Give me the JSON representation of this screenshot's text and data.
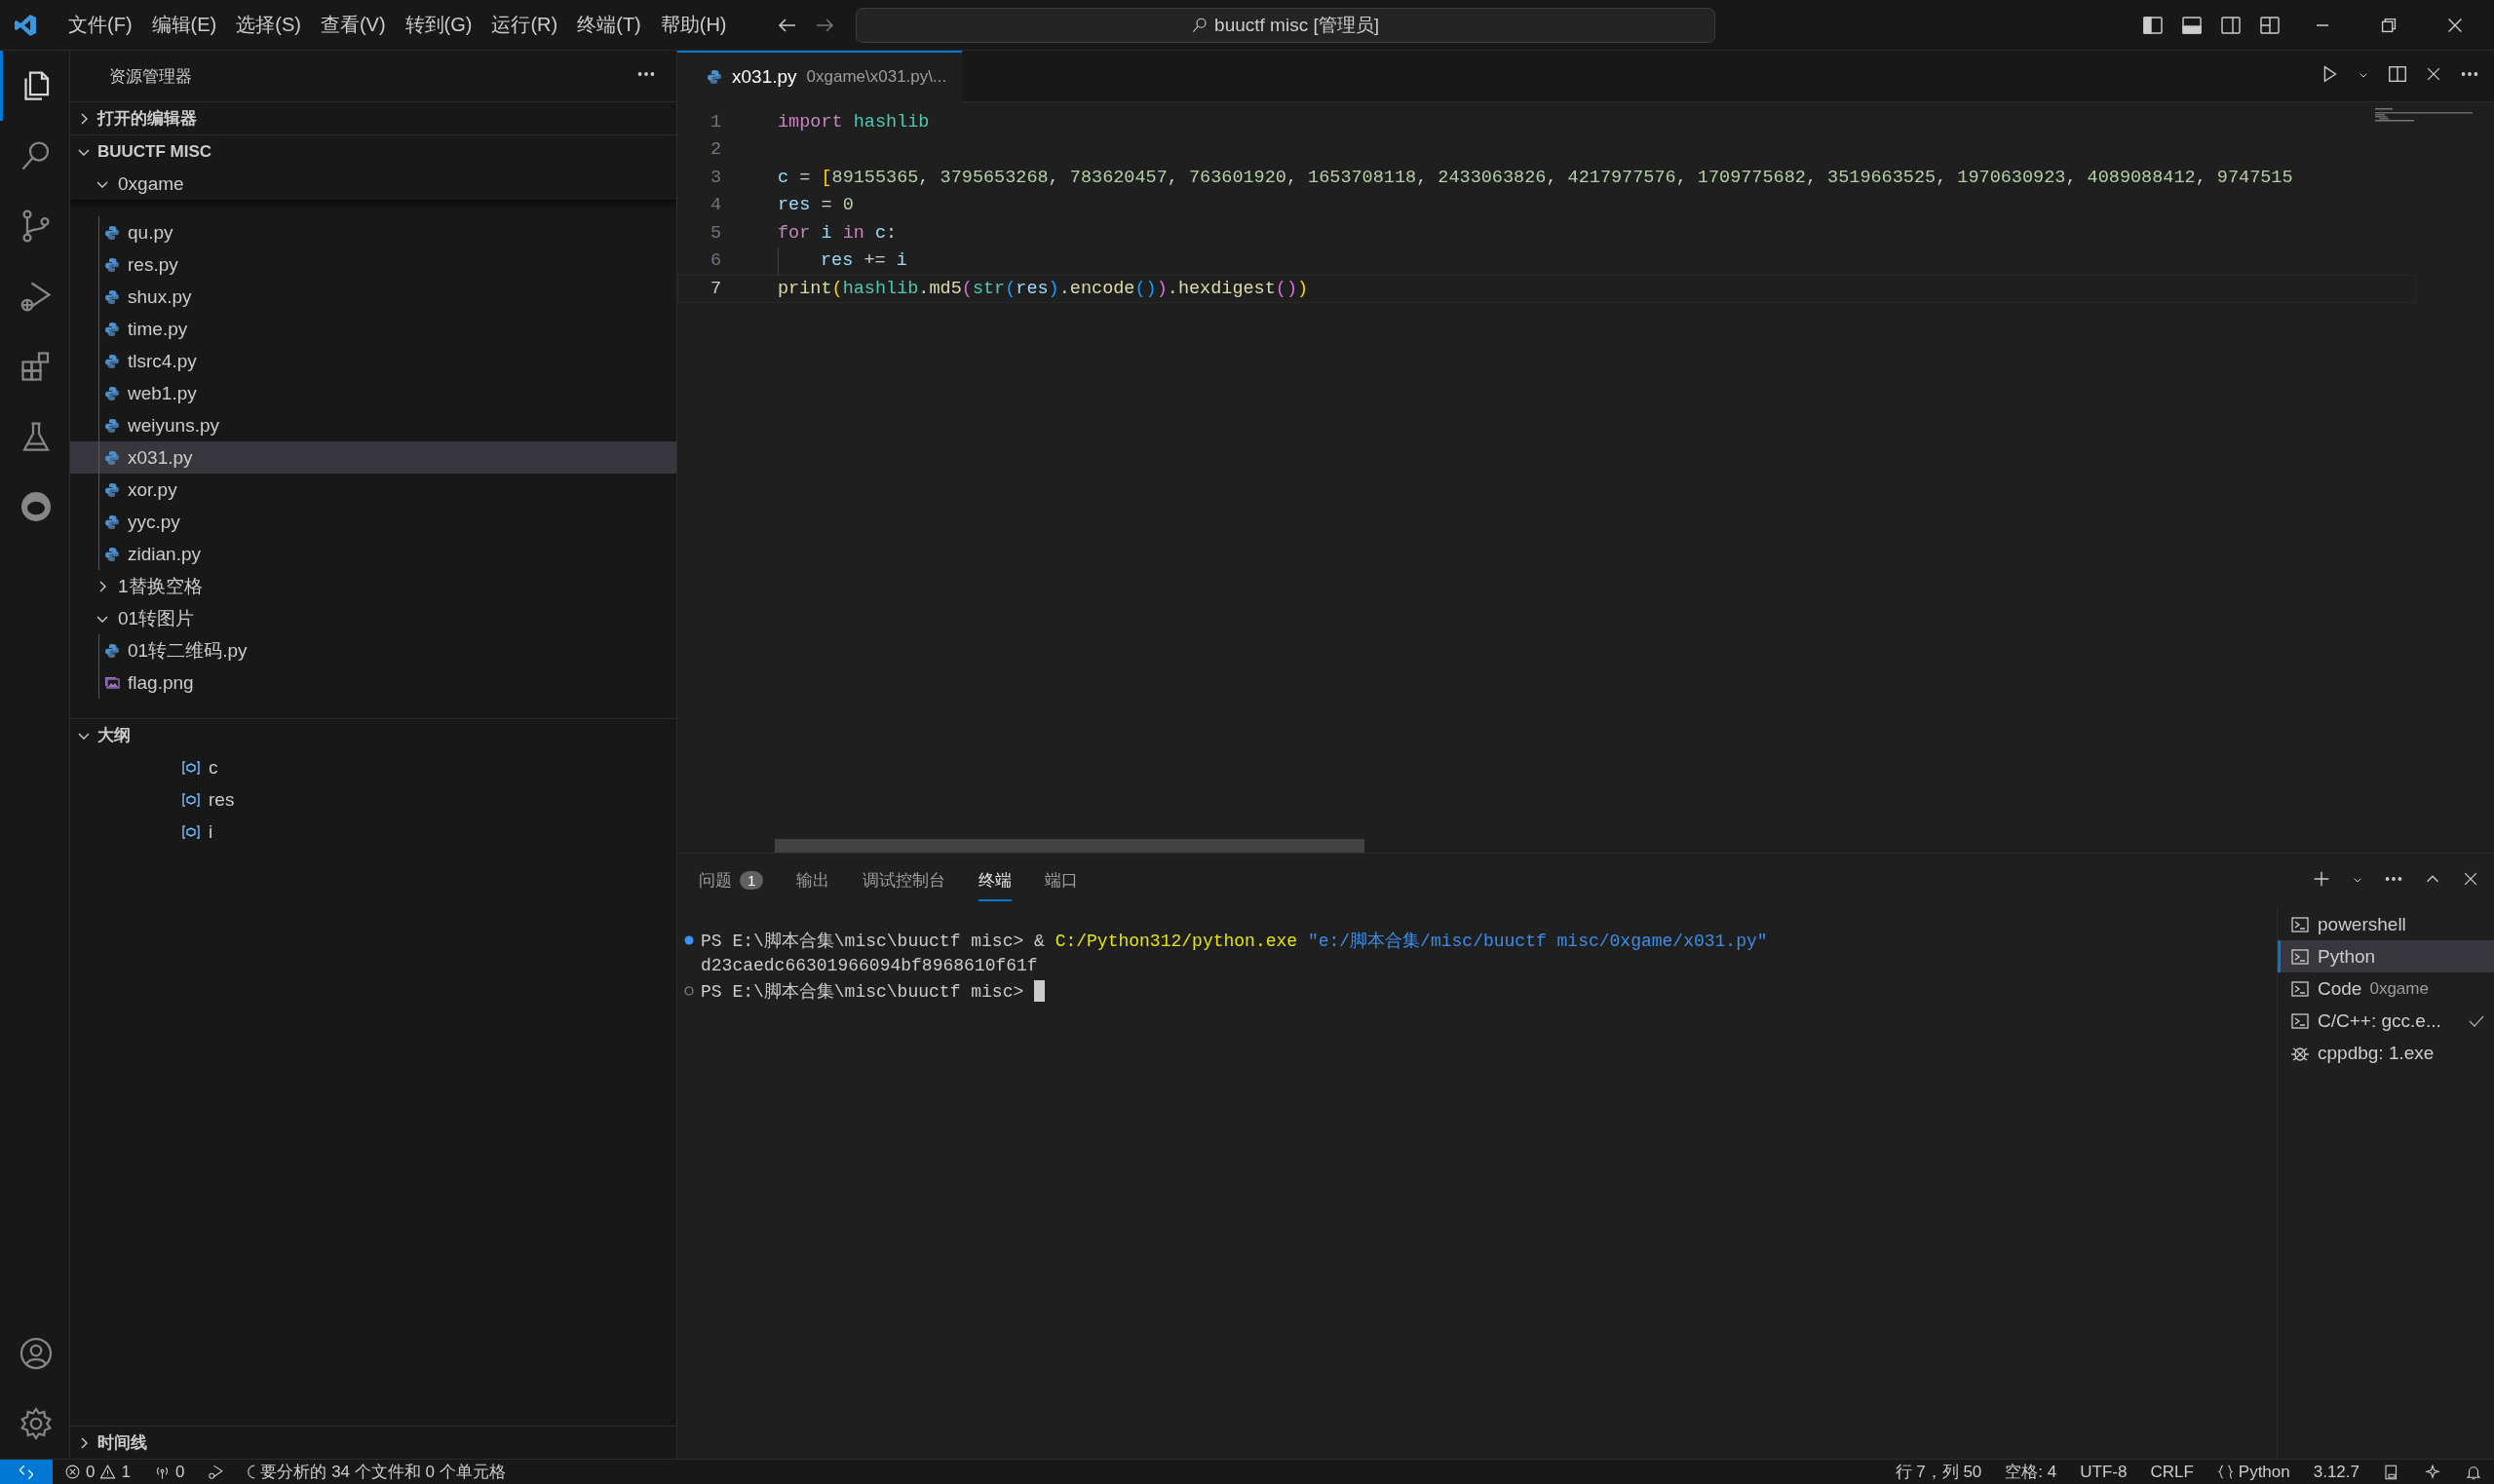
{
  "titlebar": {
    "menu": [
      "文件(F)",
      "编辑(E)",
      "选择(S)",
      "查看(V)",
      "转到(G)",
      "运行(R)",
      "终端(T)",
      "帮助(H)"
    ],
    "command_center": "buuctf misc [管理员]"
  },
  "activity_bar": [
    {
      "kind": "explorer",
      "selected": true
    },
    {
      "kind": "search",
      "selected": false
    },
    {
      "kind": "source-control",
      "selected": false
    },
    {
      "kind": "run-debug",
      "selected": false
    },
    {
      "kind": "extensions",
      "selected": false
    },
    {
      "kind": "testing",
      "selected": false
    },
    {
      "kind": "remote",
      "selected": false
    }
  ],
  "activity_bottom": [
    {
      "kind": "account"
    },
    {
      "kind": "settings"
    }
  ],
  "sidebar": {
    "title": "资源管理器",
    "open_editors": {
      "title": "打开的编辑器",
      "expanded": false
    },
    "folder": {
      "title": "BUUCTF MISC",
      "expanded": true,
      "tree": [
        {
          "name": "0xgame",
          "kind": "folder",
          "expanded": true,
          "selected": false,
          "children": [
            {
              "name": "qu.py",
              "kind": "python",
              "selected": false
            },
            {
              "name": "res.py",
              "kind": "python",
              "selected": false
            },
            {
              "name": "shux.py",
              "kind": "python",
              "selected": false
            },
            {
              "name": "time.py",
              "kind": "python",
              "selected": false
            },
            {
              "name": "tlsrc4.py",
              "kind": "python",
              "selected": false
            },
            {
              "name": "web1.py",
              "kind": "python",
              "selected": false
            },
            {
              "name": "weiyuns.py",
              "kind": "python",
              "selected": false
            },
            {
              "name": "x031.py",
              "kind": "python",
              "selected": true
            },
            {
              "name": "xor.py",
              "kind": "python",
              "selected": false
            },
            {
              "name": "yyc.py",
              "kind": "python",
              "selected": false
            },
            {
              "name": "zidian.py",
              "kind": "python",
              "selected": false
            }
          ]
        },
        {
          "name": "1替换空格",
          "kind": "folder",
          "expanded": false,
          "selected": false
        },
        {
          "name": "01转图片",
          "kind": "folder",
          "expanded": true,
          "selected": false,
          "children": [
            {
              "name": "01转二维码.py",
              "kind": "python",
              "selected": false
            },
            {
              "name": "flag.png",
              "kind": "image",
              "selected": false
            }
          ]
        }
      ]
    },
    "outline": {
      "title": "大纲",
      "expanded": true,
      "items": [
        {
          "name": "c",
          "kind": "variable"
        },
        {
          "name": "res",
          "kind": "variable"
        },
        {
          "name": "i",
          "kind": "variable"
        }
      ]
    },
    "timeline": {
      "title": "时间线",
      "expanded": false
    }
  },
  "editor": {
    "tab": {
      "name": "x031.py",
      "path": "0xgame\\x031.py\\..."
    },
    "lines": [
      {
        "number": "1",
        "current": false,
        "indent_guide": false,
        "tokens": [
          {
            "text": "import ",
            "kind": "keyword"
          },
          {
            "text": "hashlib",
            "kind": "module"
          }
        ]
      },
      {
        "number": "2",
        "current": false,
        "indent_guide": false
      },
      {
        "number": "3",
        "current": false,
        "indent_guide": false,
        "tokens": [
          {
            "text": "c",
            "kind": "variable"
          },
          {
            "text": " = ",
            "kind": "plain"
          },
          {
            "text": "[",
            "kind": "bracket1"
          },
          {
            "text": "89155365",
            "kind": "number"
          },
          {
            "text": ", ",
            "kind": "plain"
          },
          {
            "text": "3795653268",
            "kind": "number"
          },
          {
            "text": ", ",
            "kind": "plain"
          },
          {
            "text": "783620457",
            "kind": "number"
          },
          {
            "text": ", ",
            "kind": "plain"
          },
          {
            "text": "763601920",
            "kind": "number"
          },
          {
            "text": ", ",
            "kind": "plain"
          },
          {
            "text": "1653708118",
            "kind": "number"
          },
          {
            "text": ", ",
            "kind": "plain"
          },
          {
            "text": "2433063826",
            "kind": "number"
          },
          {
            "text": ", ",
            "kind": "plain"
          },
          {
            "text": "4217977576",
            "kind": "number"
          },
          {
            "text": ", ",
            "kind": "plain"
          },
          {
            "text": "1709775682",
            "kind": "number"
          },
          {
            "text": ", ",
            "kind": "plain"
          },
          {
            "text": "3519663525",
            "kind": "number"
          },
          {
            "text": ", ",
            "kind": "plain"
          },
          {
            "text": "1970630923",
            "kind": "number"
          },
          {
            "text": ", ",
            "kind": "plain"
          },
          {
            "text": "4089088412",
            "kind": "number"
          },
          {
            "text": ", ",
            "kind": "plain"
          },
          {
            "text": "9747515",
            "kind": "number"
          }
        ]
      },
      {
        "number": "4",
        "current": false,
        "indent_guide": false,
        "tokens": [
          {
            "text": "res",
            "kind": "variable"
          },
          {
            "text": " = ",
            "kind": "plain"
          },
          {
            "text": "0",
            "kind": "number"
          }
        ]
      },
      {
        "number": "5",
        "current": false,
        "indent_guide": false,
        "tokens": [
          {
            "text": "for ",
            "kind": "keyword"
          },
          {
            "text": "i",
            "kind": "variable"
          },
          {
            "text": " in ",
            "kind": "keyword"
          },
          {
            "text": "c",
            "kind": "variable"
          },
          {
            "text": ":",
            "kind": "plain"
          }
        ]
      },
      {
        "number": "6",
        "current": false,
        "indent_guide": true,
        "tokens": [
          {
            "text": "res",
            "kind": "variable"
          },
          {
            "text": " += ",
            "kind": "plain"
          },
          {
            "text": "i",
            "kind": "variable"
          }
        ]
      },
      {
        "number": "7",
        "current": true,
        "indent_guide": false,
        "tokens": [
          {
            "text": "print",
            "kind": "function"
          },
          {
            "text": "(",
            "kind": "bracket1"
          },
          {
            "text": "hashlib",
            "kind": "module"
          },
          {
            "text": ".",
            "kind": "plain"
          },
          {
            "text": "md5",
            "kind": "function"
          },
          {
            "text": "(",
            "kind": "bracket2"
          },
          {
            "text": "str",
            "kind": "module"
          },
          {
            "text": "(",
            "kind": "bracket3"
          },
          {
            "text": "res",
            "kind": "variable"
          },
          {
            "text": ")",
            "kind": "bracket3"
          },
          {
            "text": ".",
            "kind": "plain"
          },
          {
            "text": "encode",
            "kind": "function"
          },
          {
            "text": "()",
            "kind": "bracket3"
          },
          {
            "text": ")",
            "kind": "bracket2"
          },
          {
            "text": ".",
            "kind": "plain"
          },
          {
            "text": "hexdigest",
            "kind": "function"
          },
          {
            "text": "()",
            "kind": "bracket2"
          },
          {
            "text": ")",
            "kind": "bracket1"
          }
        ]
      }
    ]
  },
  "panel": {
    "tabs": [
      {
        "label": "问题",
        "badge": "1",
        "selected": false
      },
      {
        "label": "输出",
        "selected": false
      },
      {
        "label": "调试控制台",
        "selected": false
      },
      {
        "label": "终端",
        "selected": true
      },
      {
        "label": "端口",
        "selected": false
      }
    ],
    "terminal": [
      {
        "marker": true,
        "completed": true,
        "cursor": false,
        "segments": [
          {
            "text": "PS E:\\脚本合集\\misc\\buuctf misc> & ",
            "kind": "plain"
          },
          {
            "text": "C:/Python312/python.exe",
            "kind": "command"
          },
          {
            "text": " \"e:/脚本合集/misc/buuctf misc/0xgame/x031.py\"",
            "kind": "string"
          }
        ]
      },
      {
        "marker": false,
        "cursor": false,
        "segments": [
          {
            "text": "d23caedc66301966094bf8968610f61f",
            "kind": "plain"
          }
        ]
      },
      {
        "marker": true,
        "completed": false,
        "cursor": true,
        "segments": [
          {
            "text": "PS E:\\脚本合集\\misc\\buuctf misc> ",
            "kind": "plain"
          }
        ]
      }
    ],
    "terminal_list": [
      {
        "kind": "terminal",
        "name": "powershell",
        "selected": false,
        "done": false
      },
      {
        "kind": "terminal",
        "name": "Python",
        "selected": true,
        "done": false
      },
      {
        "kind": "terminal",
        "name": "Code",
        "detail": "0xgame",
        "selected": false,
        "done": false
      },
      {
        "kind": "terminal",
        "name": "C/C++: gcc.e...",
        "selected": false,
        "done": true
      },
      {
        "kind": "debug",
        "name": "cppdbg: 1.exe",
        "selected": false,
        "done": false
      }
    ]
  },
  "status_bar": {
    "left": [
      {
        "kind": "remote"
      },
      {
        "kind": "problems",
        "errors": "0",
        "warnings": "1"
      },
      {
        "kind": "ports",
        "text": "0"
      },
      {
        "kind": "run"
      },
      {
        "kind": "progress",
        "text": "要分析的 34 个文件和 0 个单元格"
      }
    ],
    "right": [
      {
        "kind": "text",
        "text": "行 7，列 50"
      },
      {
        "kind": "text",
        "text": "空格: 4"
      },
      {
        "kind": "text",
        "text": "UTF-8"
      },
      {
        "kind": "text",
        "text": "CRLF"
      },
      {
        "kind": "language",
        "text": "Python"
      },
      {
        "kind": "text",
        "text": "3.12.7"
      },
      {
        "kind": "layout"
      },
      {
        "kind": "copilot"
      },
      {
        "kind": "bell"
      }
    ]
  }
}
